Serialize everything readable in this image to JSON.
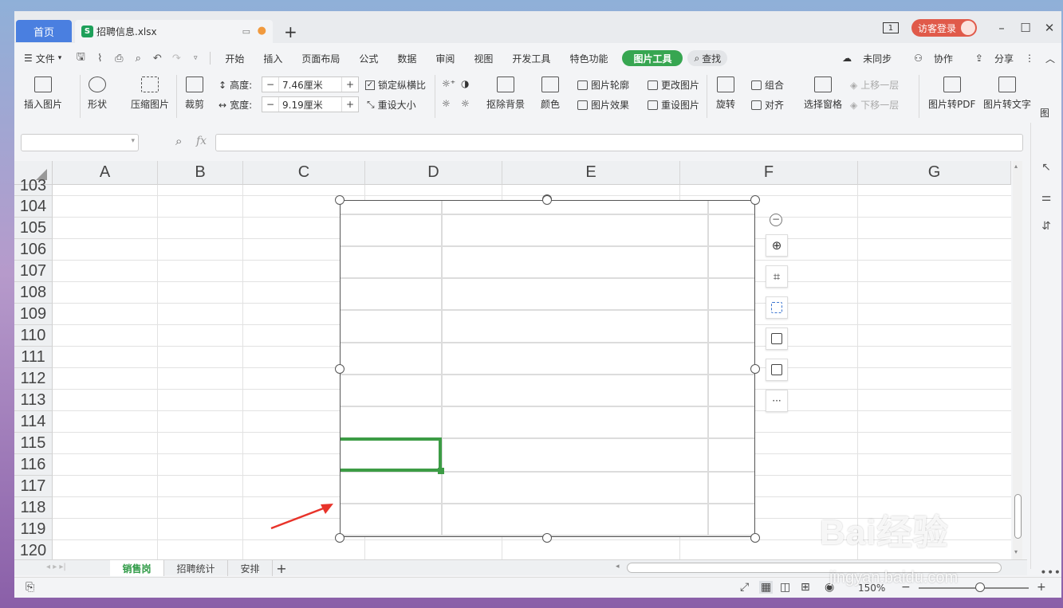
{
  "titlebar": {
    "home_tab": "首页",
    "file_tab": "招聘信息.xlsx",
    "file_icon_letter": "S",
    "new_tab": "+",
    "badge": "1",
    "login": "访客登录"
  },
  "menu": {
    "file": "文件",
    "tabs": [
      "开始",
      "插入",
      "页面布局",
      "公式",
      "数据",
      "审阅",
      "视图",
      "开发工具",
      "特色功能"
    ],
    "active_tab": "图片工具",
    "search": "查找",
    "sync": "未同步",
    "collab": "协作",
    "share": "分享"
  },
  "ribbon": {
    "insert_pic": "插入图片",
    "shape": "形状",
    "compress": "压缩图片",
    "crop": "裁剪",
    "height_label": "高度:",
    "height_value": "7.46厘米",
    "width_label": "宽度:",
    "width_value": "9.19厘米",
    "lock_ratio": "锁定纵横比",
    "reset_size": "重设大小",
    "remove_bg": "抠除背景",
    "color": "颜色",
    "pic_outline": "图片轮廓",
    "pic_effect": "图片效果",
    "change_pic": "更改图片",
    "reset_pic": "重设图片",
    "rotate": "旋转",
    "group": "组合",
    "align": "对齐",
    "select_pane": "选择窗格",
    "bring_forward": "上移一层",
    "send_backward": "下移一层",
    "to_pdf": "图片转PDF",
    "to_text": "图片转文字",
    "more": "图"
  },
  "formula": {
    "fx": "fx"
  },
  "grid": {
    "columns": [
      "A",
      "B",
      "C",
      "D",
      "E",
      "F",
      "G"
    ],
    "rows": [
      "103",
      "104",
      "105",
      "106",
      "107",
      "108",
      "109",
      "110",
      "111",
      "112",
      "113",
      "114",
      "115",
      "116",
      "117",
      "118",
      "119",
      "120"
    ]
  },
  "sheets": [
    "销售岗",
    "招聘统计",
    "安排"
  ],
  "status": {
    "zoom": "150%"
  },
  "watermark": {
    "brand": "Bai经验",
    "url": "jingyan.baidu.com"
  },
  "colors": {
    "accent": "#37a651",
    "home_tab": "#4a7fe0",
    "login": "#e05a4a",
    "arrow": "#e8332a"
  }
}
